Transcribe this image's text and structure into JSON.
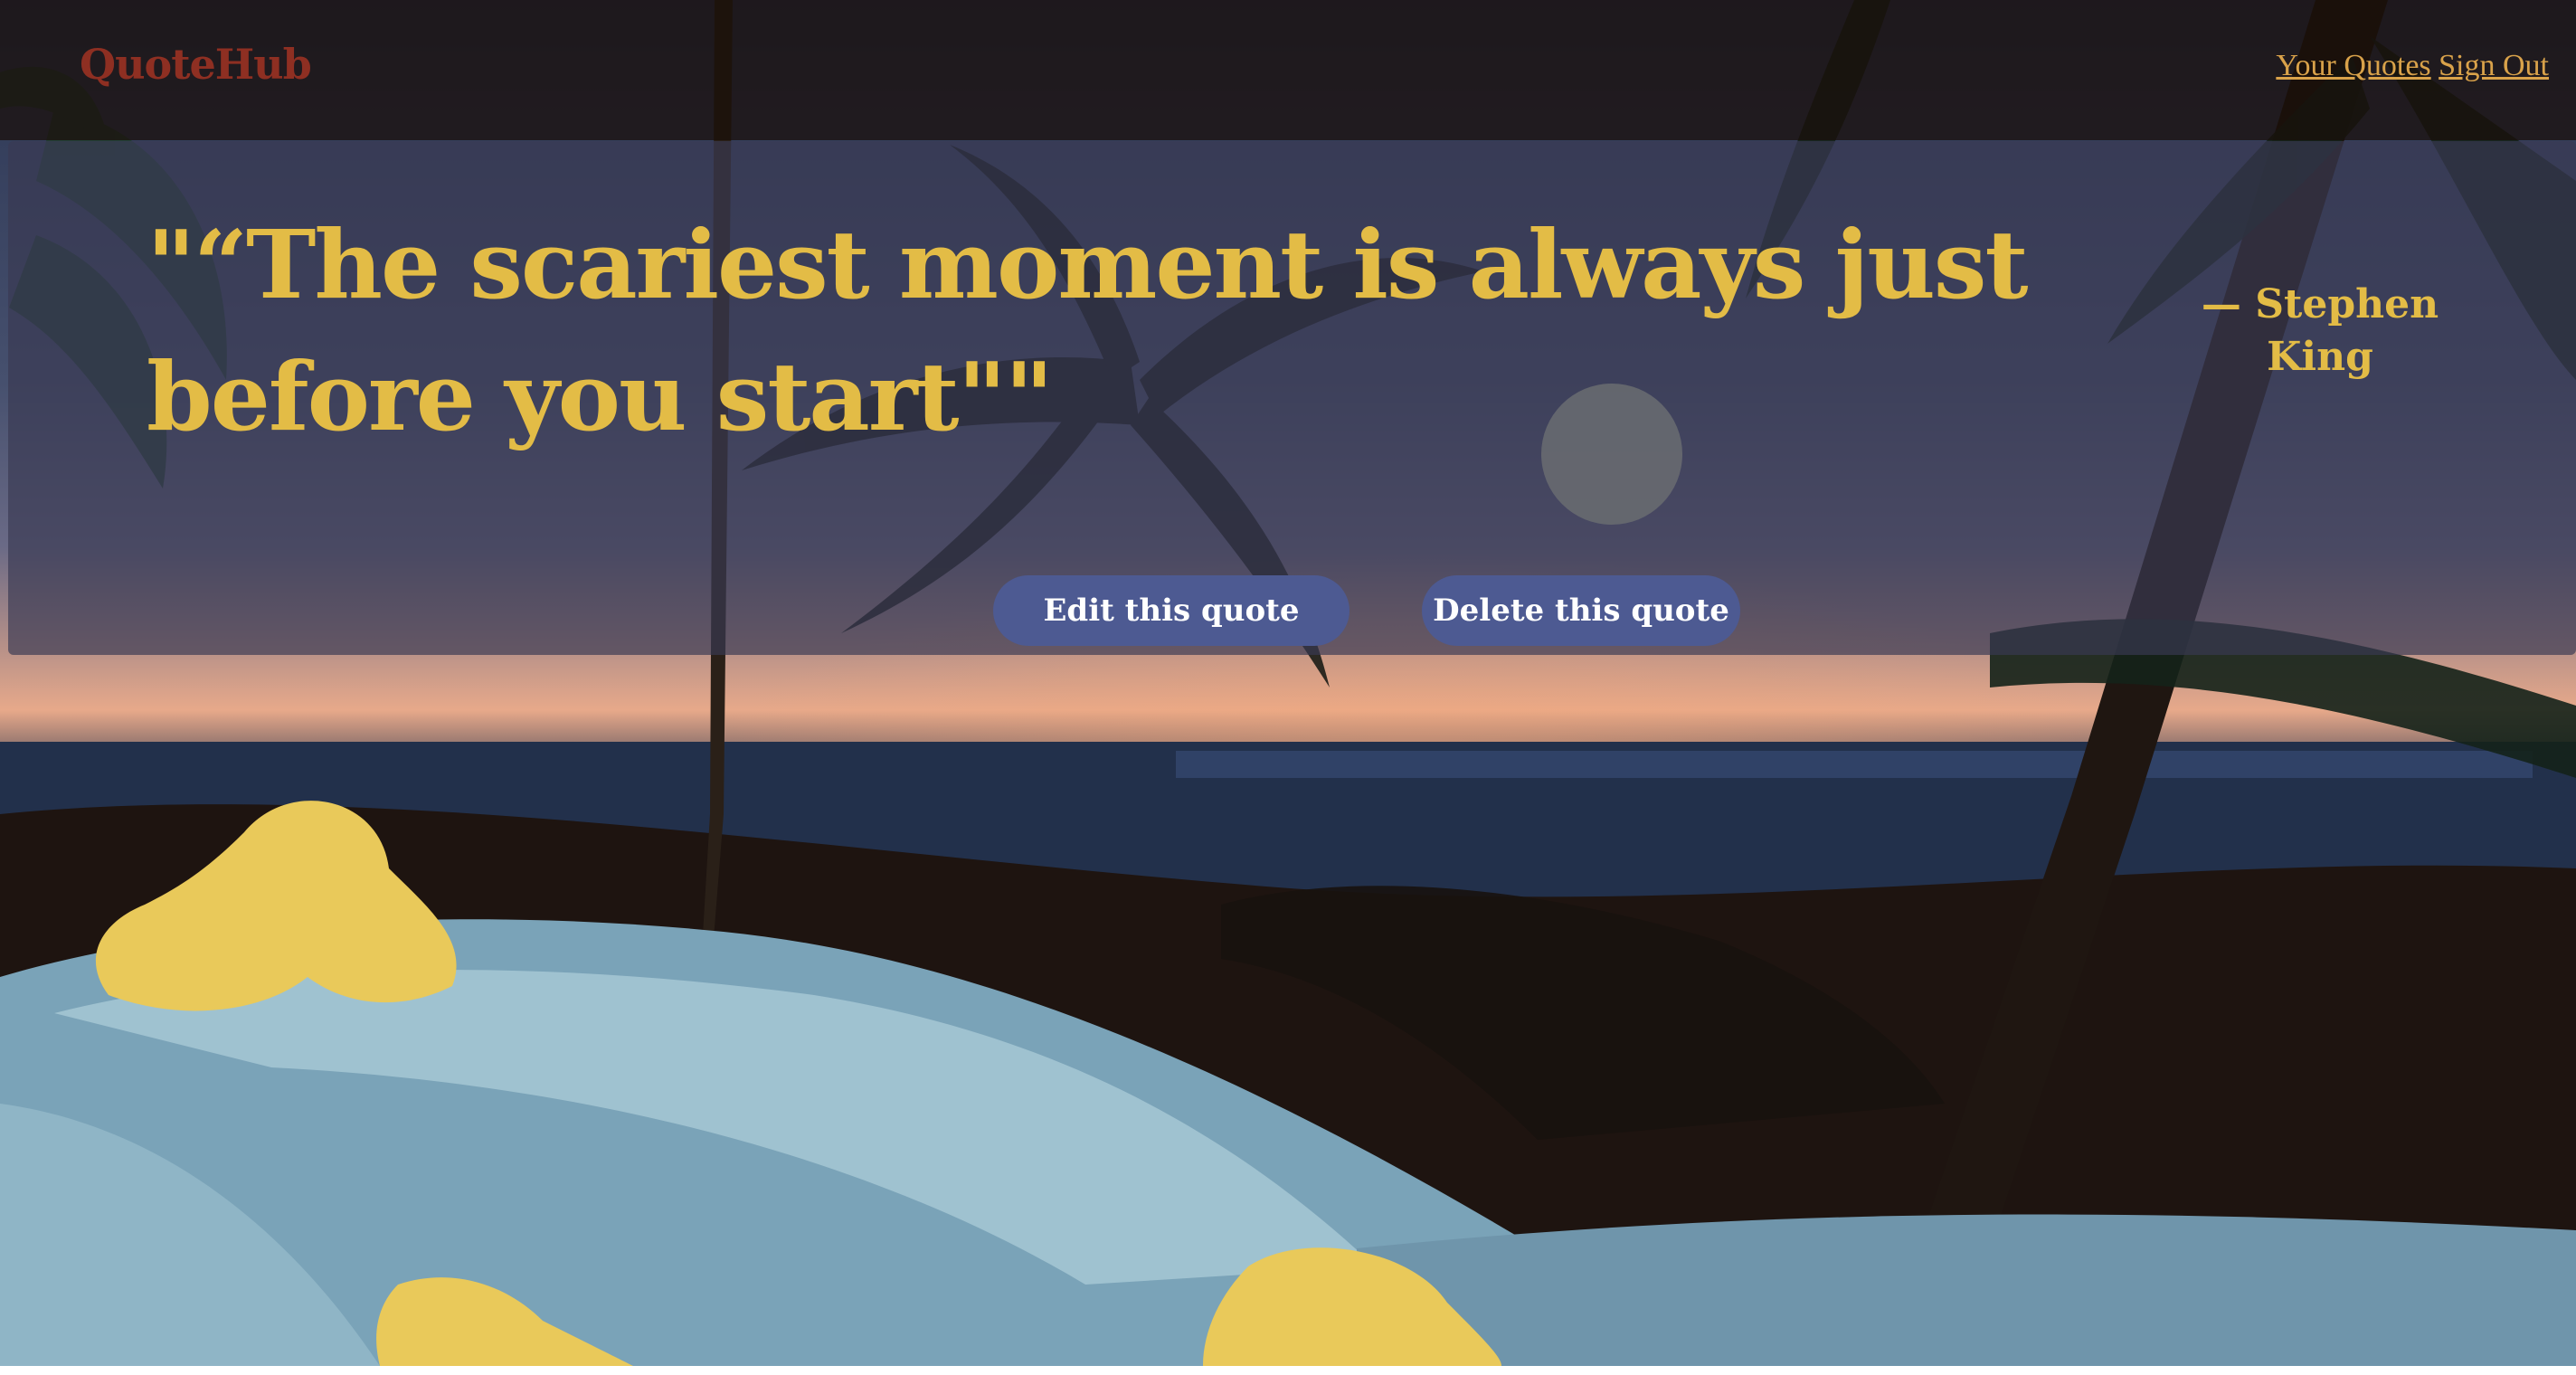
{
  "header": {
    "brand": "QuoteHub",
    "nav": {
      "your_quotes": "Your Quotes",
      "sign_out": "Sign Out"
    }
  },
  "quote": {
    "text": "\"“The scariest moment is always just before you start\"\"",
    "author": "— Stephen King"
  },
  "actions": {
    "edit_label": "Edit this quote",
    "delete_label": "Delete this quote"
  },
  "colors": {
    "brand": "#8e2f22",
    "nav_link": "#d9a24a",
    "quote_text": "#e3bc46",
    "button_bg": "#4d5a92",
    "button_text": "#ffffff"
  }
}
